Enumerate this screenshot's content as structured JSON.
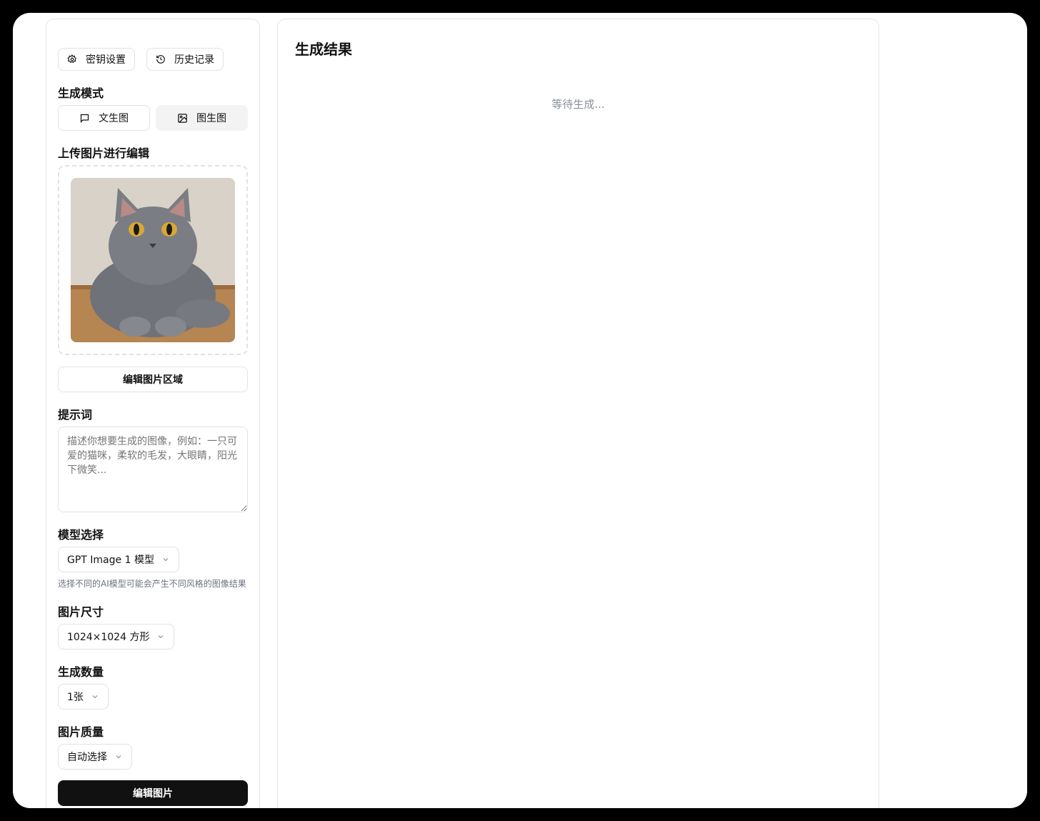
{
  "toolbar": {
    "key_settings_label": "密钥设置",
    "history_label": "历史记录"
  },
  "mode": {
    "label": "生成模式",
    "text_to_image": "文生图",
    "image_to_image": "图生图",
    "active": "image_to_image"
  },
  "upload": {
    "label": "上传图片进行编辑",
    "edit_area_button": "编辑图片区域"
  },
  "prompt": {
    "label": "提示词",
    "placeholder": "描述你想要生成的图像，例如：一只可爱的猫咪，柔软的毛发，大眼睛，阳光下微笑..."
  },
  "model": {
    "label": "模型选择",
    "selected": "GPT Image 1 模型",
    "hint": "选择不同的AI模型可能会产生不同风格的图像结果"
  },
  "size": {
    "label": "图片尺寸",
    "selected": "1024×1024 方形"
  },
  "count": {
    "label": "生成数量",
    "selected": "1张"
  },
  "quality": {
    "label": "图片质量",
    "selected": "自动选择"
  },
  "submit_label": "编辑图片",
  "result": {
    "title": "生成结果",
    "status": "等待生成..."
  }
}
